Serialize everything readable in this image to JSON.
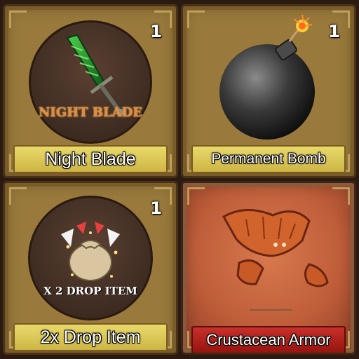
{
  "items": [
    {
      "name": "Night Blade",
      "count": "1",
      "icon": "sword-icon",
      "badge_text": "NIGHT BLADE",
      "rarity_color": "#9a7a3c"
    },
    {
      "name": "Permanent Bomb",
      "count": "1",
      "icon": "bomb-icon",
      "rarity_color": "#9a7a3c"
    },
    {
      "name": "2x Drop Item",
      "count": "1",
      "icon": "loot-bag-icon",
      "badge_text": "X 2 DROP ITEM",
      "rarity_color": "#9a7a3c"
    },
    {
      "name": "Crustacean Armor",
      "icon": "crustacean-armor-icon",
      "rarity_color": "#c8302a"
    }
  ]
}
